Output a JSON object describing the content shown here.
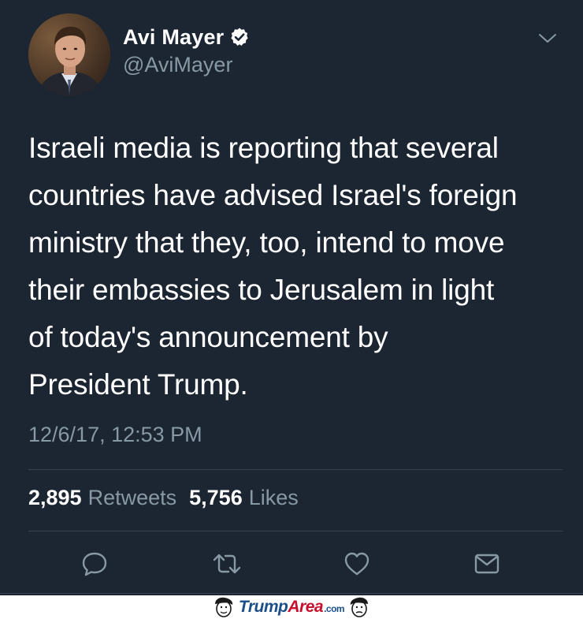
{
  "user": {
    "display_name": "Avi Mayer",
    "handle": "@AviMayer",
    "verified": true
  },
  "tweet": {
    "text_lines": [
      "Israeli media is reporting that several",
      "countries have advised Israel's foreign",
      "ministry that they, too, intend to move",
      "their embassies to Jerusalem in light",
      "of today's announcement by",
      "President Trump."
    ],
    "timestamp": "12/6/17, 12:53 PM"
  },
  "stats": {
    "retweets_count": "2,895",
    "retweets_label": "Retweets",
    "likes_count": "5,756",
    "likes_label": "Likes"
  },
  "actions": [
    {
      "icon": "reply-icon"
    },
    {
      "icon": "retweet-icon"
    },
    {
      "icon": "like-icon"
    },
    {
      "icon": "direct-message-icon"
    }
  ],
  "watermark": {
    "part1": "Trump",
    "part2": "Area",
    "part3": ".com"
  },
  "colors": {
    "background": "#1c2532",
    "secondary_text": "#8899a6",
    "divider": "#38444d",
    "watermark_blue": "#1a4f8a",
    "watermark_red": "#c8102e"
  }
}
